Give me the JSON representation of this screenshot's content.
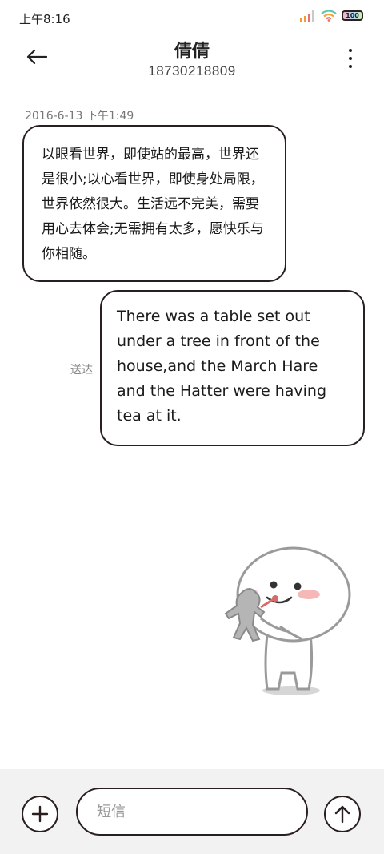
{
  "status_bar": {
    "time": "上午8:16",
    "battery": "100"
  },
  "header": {
    "contact_name": "倩倩",
    "phone_number": "18730218809"
  },
  "conversation": {
    "timestamp": "2016-6-13 下午1:49",
    "incoming_message": "以眼看世界，即使站的最高，世界还是很小;以心看世界，即使身处局限，世界依然很大。生活远不完美，需要用心去体会;无需拥有太多，愿快乐与你相随。",
    "outgoing_message": "There was a table set out under a tree in front of the house,and the March Hare and the Hatter were having tea at it.",
    "delivery_status": "送达"
  },
  "composer": {
    "placeholder": "短信"
  },
  "colors": {
    "border": "#2a1f1f",
    "input_bar_bg": "#f2f2f2",
    "blush": "#f6b7b7"
  },
  "icons": {
    "back": "back-arrow-icon",
    "more": "more-vertical-icon",
    "add": "plus-icon",
    "send": "send-arrow-up-icon"
  }
}
